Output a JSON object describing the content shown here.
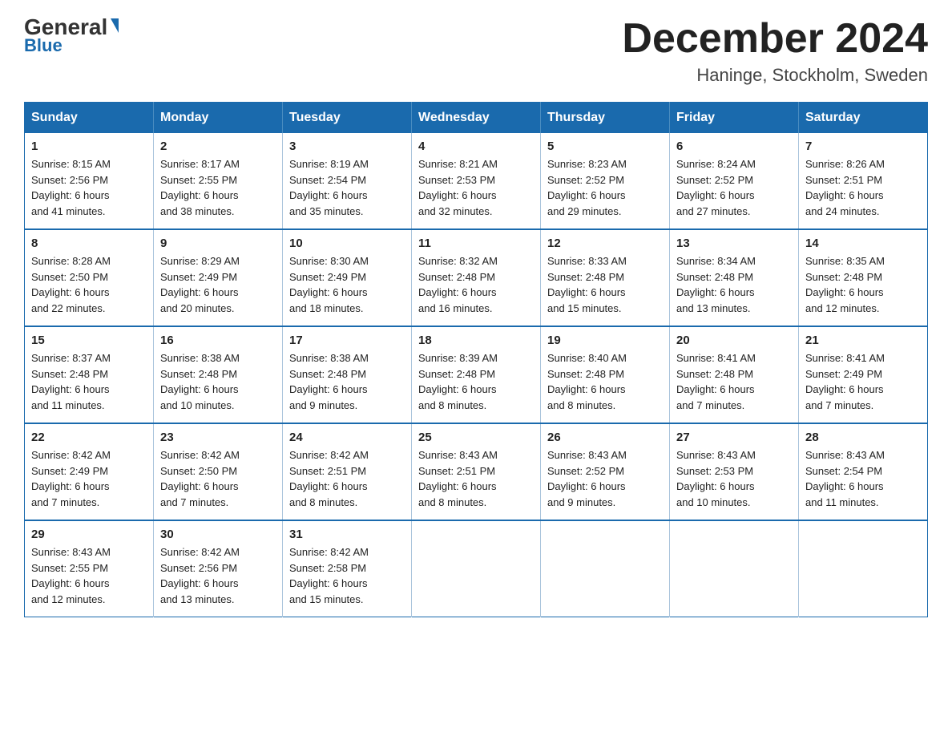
{
  "header": {
    "logo": {
      "general": "General",
      "blue": "Blue"
    },
    "title": "December 2024",
    "subtitle": "Haninge, Stockholm, Sweden"
  },
  "calendar": {
    "days_of_week": [
      "Sunday",
      "Monday",
      "Tuesday",
      "Wednesday",
      "Thursday",
      "Friday",
      "Saturday"
    ],
    "weeks": [
      [
        {
          "day": "1",
          "sunrise": "8:15 AM",
          "sunset": "2:56 PM",
          "daylight": "6 hours and 41 minutes."
        },
        {
          "day": "2",
          "sunrise": "8:17 AM",
          "sunset": "2:55 PM",
          "daylight": "6 hours and 38 minutes."
        },
        {
          "day": "3",
          "sunrise": "8:19 AM",
          "sunset": "2:54 PM",
          "daylight": "6 hours and 35 minutes."
        },
        {
          "day": "4",
          "sunrise": "8:21 AM",
          "sunset": "2:53 PM",
          "daylight": "6 hours and 32 minutes."
        },
        {
          "day": "5",
          "sunrise": "8:23 AM",
          "sunset": "2:52 PM",
          "daylight": "6 hours and 29 minutes."
        },
        {
          "day": "6",
          "sunrise": "8:24 AM",
          "sunset": "2:52 PM",
          "daylight": "6 hours and 27 minutes."
        },
        {
          "day": "7",
          "sunrise": "8:26 AM",
          "sunset": "2:51 PM",
          "daylight": "6 hours and 24 minutes."
        }
      ],
      [
        {
          "day": "8",
          "sunrise": "8:28 AM",
          "sunset": "2:50 PM",
          "daylight": "6 hours and 22 minutes."
        },
        {
          "day": "9",
          "sunrise": "8:29 AM",
          "sunset": "2:49 PM",
          "daylight": "6 hours and 20 minutes."
        },
        {
          "day": "10",
          "sunrise": "8:30 AM",
          "sunset": "2:49 PM",
          "daylight": "6 hours and 18 minutes."
        },
        {
          "day": "11",
          "sunrise": "8:32 AM",
          "sunset": "2:48 PM",
          "daylight": "6 hours and 16 minutes."
        },
        {
          "day": "12",
          "sunrise": "8:33 AM",
          "sunset": "2:48 PM",
          "daylight": "6 hours and 15 minutes."
        },
        {
          "day": "13",
          "sunrise": "8:34 AM",
          "sunset": "2:48 PM",
          "daylight": "6 hours and 13 minutes."
        },
        {
          "day": "14",
          "sunrise": "8:35 AM",
          "sunset": "2:48 PM",
          "daylight": "6 hours and 12 minutes."
        }
      ],
      [
        {
          "day": "15",
          "sunrise": "8:37 AM",
          "sunset": "2:48 PM",
          "daylight": "6 hours and 11 minutes."
        },
        {
          "day": "16",
          "sunrise": "8:38 AM",
          "sunset": "2:48 PM",
          "daylight": "6 hours and 10 minutes."
        },
        {
          "day": "17",
          "sunrise": "8:38 AM",
          "sunset": "2:48 PM",
          "daylight": "6 hours and 9 minutes."
        },
        {
          "day": "18",
          "sunrise": "8:39 AM",
          "sunset": "2:48 PM",
          "daylight": "6 hours and 8 minutes."
        },
        {
          "day": "19",
          "sunrise": "8:40 AM",
          "sunset": "2:48 PM",
          "daylight": "6 hours and 8 minutes."
        },
        {
          "day": "20",
          "sunrise": "8:41 AM",
          "sunset": "2:48 PM",
          "daylight": "6 hours and 7 minutes."
        },
        {
          "day": "21",
          "sunrise": "8:41 AM",
          "sunset": "2:49 PM",
          "daylight": "6 hours and 7 minutes."
        }
      ],
      [
        {
          "day": "22",
          "sunrise": "8:42 AM",
          "sunset": "2:49 PM",
          "daylight": "6 hours and 7 minutes."
        },
        {
          "day": "23",
          "sunrise": "8:42 AM",
          "sunset": "2:50 PM",
          "daylight": "6 hours and 7 minutes."
        },
        {
          "day": "24",
          "sunrise": "8:42 AM",
          "sunset": "2:51 PM",
          "daylight": "6 hours and 8 minutes."
        },
        {
          "day": "25",
          "sunrise": "8:43 AM",
          "sunset": "2:51 PM",
          "daylight": "6 hours and 8 minutes."
        },
        {
          "day": "26",
          "sunrise": "8:43 AM",
          "sunset": "2:52 PM",
          "daylight": "6 hours and 9 minutes."
        },
        {
          "day": "27",
          "sunrise": "8:43 AM",
          "sunset": "2:53 PM",
          "daylight": "6 hours and 10 minutes."
        },
        {
          "day": "28",
          "sunrise": "8:43 AM",
          "sunset": "2:54 PM",
          "daylight": "6 hours and 11 minutes."
        }
      ],
      [
        {
          "day": "29",
          "sunrise": "8:43 AM",
          "sunset": "2:55 PM",
          "daylight": "6 hours and 12 minutes."
        },
        {
          "day": "30",
          "sunrise": "8:42 AM",
          "sunset": "2:56 PM",
          "daylight": "6 hours and 13 minutes."
        },
        {
          "day": "31",
          "sunrise": "8:42 AM",
          "sunset": "2:58 PM",
          "daylight": "6 hours and 15 minutes."
        },
        null,
        null,
        null,
        null
      ]
    ]
  },
  "labels": {
    "sunrise": "Sunrise:",
    "sunset": "Sunset:",
    "daylight": "Daylight:"
  }
}
